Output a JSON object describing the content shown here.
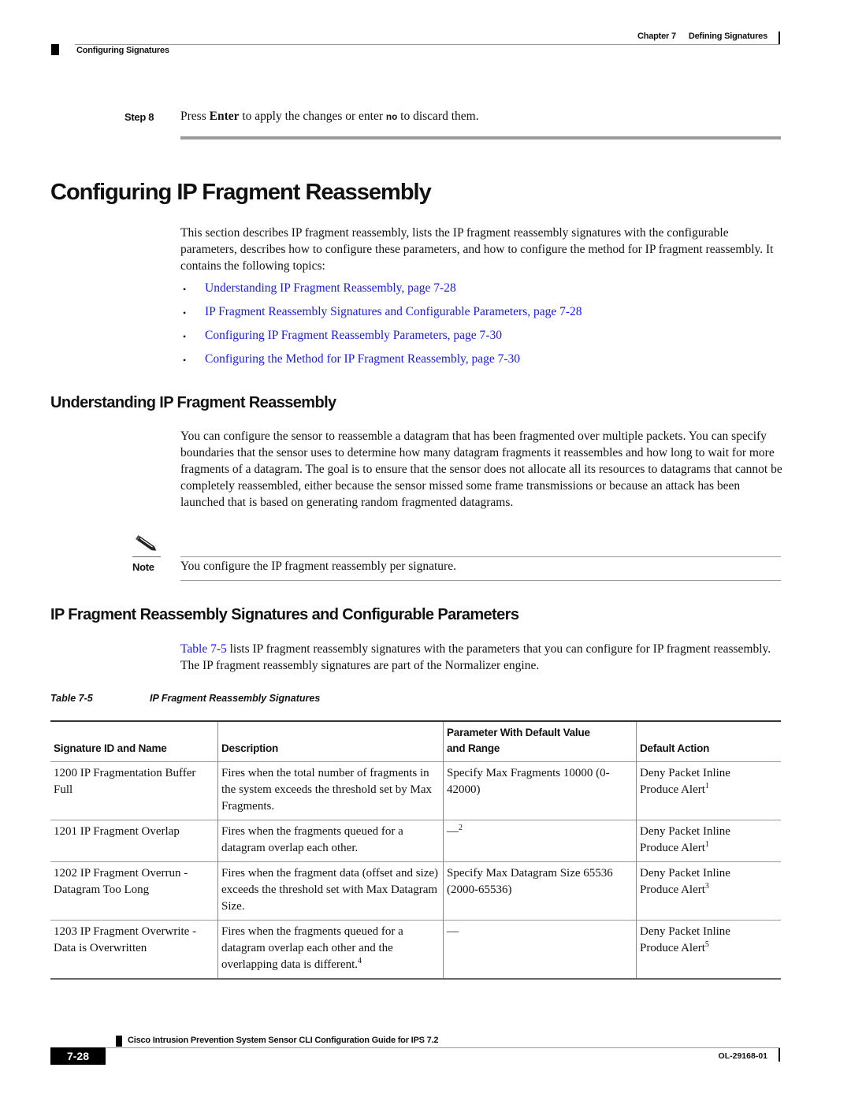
{
  "header": {
    "chapter": "Chapter 7",
    "chapter_title": "Defining Signatures",
    "section": "Configuring Signatures"
  },
  "step": {
    "label": "Step 8",
    "text_before": "Press ",
    "key": "Enter",
    "text_mid": " to apply the changes or enter ",
    "command": "no",
    "text_after": " to discard them."
  },
  "main": {
    "title": "Configuring IP Fragment Reassembly",
    "intro": "This section describes IP fragment reassembly, lists the IP fragment reassembly signatures with the configurable parameters, describes how to configure these parameters, and how to configure the method for IP fragment reassembly. It contains the following topics:",
    "topics": [
      {
        "label": "Understanding IP Fragment Reassembly, page 7-28"
      },
      {
        "label": "IP Fragment Reassembly Signatures and Configurable Parameters, page 7-28"
      },
      {
        "label": "Configuring IP Fragment Reassembly Parameters, page 7-30"
      },
      {
        "label": "Configuring the Method for IP Fragment Reassembly, page 7-30"
      }
    ],
    "bullet": "•"
  },
  "understanding": {
    "title": "Understanding IP Fragment Reassembly",
    "body": "You can configure the sensor to reassemble a datagram that has been fragmented over multiple packets. You can specify boundaries that the sensor uses to determine how many datagram fragments it reassembles and how long to wait for more fragments of a datagram. The goal is to ensure that the sensor does not allocate all its resources to datagrams that cannot be completely reassembled, either because the sensor missed some frame transmissions or because an attack has been launched that is based on generating random fragmented datagrams.",
    "note": {
      "icon": "pencil-note-icon",
      "label": "Note",
      "text": "You configure the IP fragment reassembly per signature."
    }
  },
  "signatures_section": {
    "title": "IP Fragment Reassembly Signatures and Configurable Parameters",
    "table_ref": "Table 7-5",
    "body_rest": " lists IP fragment reassembly signatures with the parameters that you can configure for IP fragment reassembly. The IP fragment reassembly signatures are part of the Normalizer engine."
  },
  "table": {
    "caption_label": "Table 7-5",
    "caption_title": "IP Fragment Reassembly Signatures",
    "headers": {
      "sig": "Signature ID and Name",
      "desc": "Description",
      "param_line1": "Parameter With Default Value",
      "param_line2": "and Range",
      "action": "Default Action"
    },
    "rows": [
      {
        "sig": "1200 IP Fragmentation Buffer Full",
        "desc": "Fires when the total number of fragments in the system exceeds the threshold set by Max Fragments.",
        "desc_sup": "",
        "param": "Specify Max Fragments 10000 (0-42000)",
        "param_sup": "",
        "action_line1": "Deny Packet Inline",
        "action_line2": "Produce Alert",
        "action_sup": "1"
      },
      {
        "sig": "1201 IP Fragment Overlap",
        "desc": "Fires when the fragments queued for a datagram overlap each other.",
        "desc_sup": "",
        "param": "—",
        "param_sup": "2",
        "action_line1": "Deny Packet Inline",
        "action_line2": "Produce Alert",
        "action_sup": "1"
      },
      {
        "sig": "1202 IP Fragment Overrun - Datagram Too Long",
        "desc": "Fires when the fragment data (offset and size) exceeds the threshold set with Max Datagram Size.",
        "desc_sup": "",
        "param": "Specify Max Datagram Size 65536 (2000-65536)",
        "param_sup": "",
        "action_line1": "Deny Packet Inline",
        "action_line2": "Produce Alert",
        "action_sup": "3"
      },
      {
        "sig": "1203 IP Fragment Overwrite - Data is Overwritten",
        "desc": "Fires when the fragments queued for a datagram overlap each other and the overlapping data is different.",
        "desc_sup": "4",
        "param": "—",
        "param_sup": "",
        "action_line1": "Deny Packet Inline",
        "action_line2": "Produce Alert",
        "action_sup": "5"
      }
    ]
  },
  "footer": {
    "guide_title": "Cisco Intrusion Prevention System Sensor CLI Configuration Guide for IPS 7.2",
    "page_number": "7-28",
    "doc_number": "OL-29168-01"
  },
  "colors": {
    "link": "#1a1ae6",
    "text": "#111111",
    "rule": "#999999"
  }
}
